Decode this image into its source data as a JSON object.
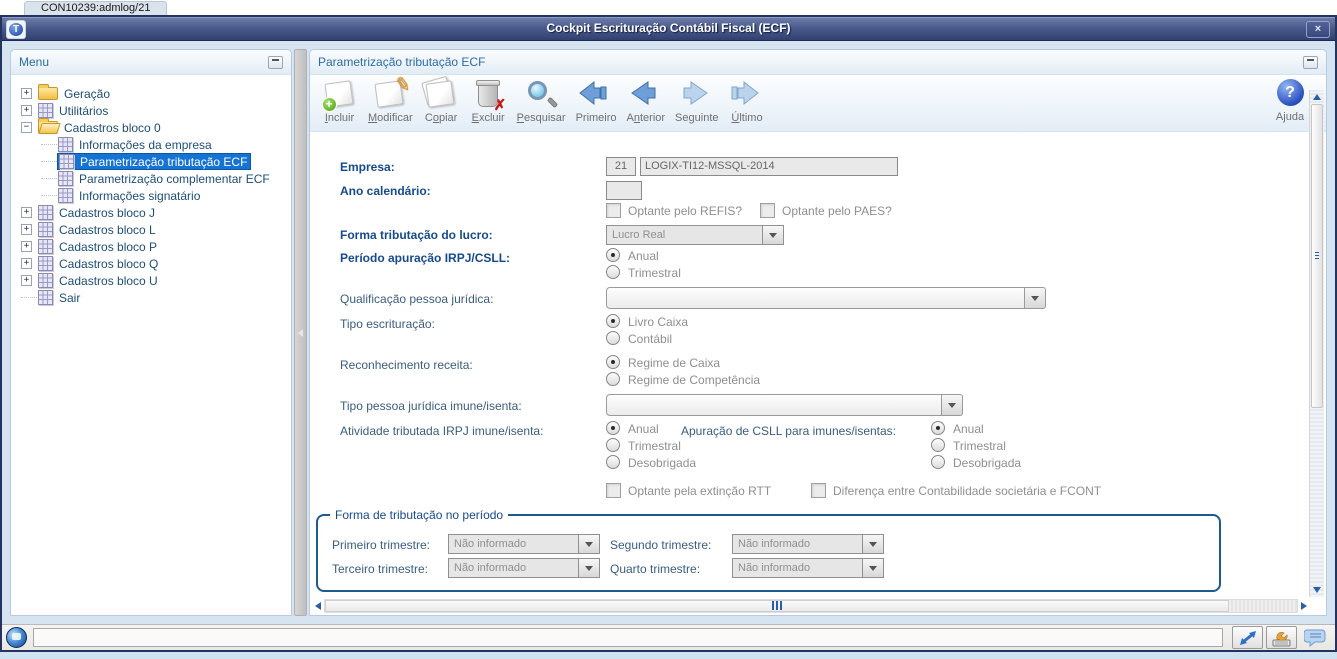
{
  "browser_tab": {
    "label": "CON10239:admlog/21"
  },
  "window": {
    "title": "Cockpit Escrituração Contábil Fiscal (ECF)",
    "logo_letter": "T",
    "close_glyph": "×"
  },
  "left_panel": {
    "header": "Menu",
    "tree": [
      {
        "label": "Geração",
        "icon": "folder",
        "expander": "plus",
        "depth": 0,
        "selected": false
      },
      {
        "label": "Utilitários",
        "icon": "grid",
        "expander": "plus",
        "depth": 0,
        "selected": false
      },
      {
        "label": "Cadastros bloco 0",
        "icon": "folder-open",
        "expander": "minus",
        "depth": 0,
        "selected": false
      },
      {
        "label": "Informações da empresa",
        "icon": "grid",
        "expander": "none",
        "depth": 1,
        "selected": false
      },
      {
        "label": "Parametrização tributação ECF",
        "icon": "grid",
        "expander": "none",
        "depth": 1,
        "selected": true
      },
      {
        "label": "Parametrização complementar ECF",
        "icon": "grid",
        "expander": "none",
        "depth": 1,
        "selected": false
      },
      {
        "label": "Informações signatário",
        "icon": "grid",
        "expander": "none",
        "depth": 1,
        "selected": false
      },
      {
        "label": "Cadastros bloco J",
        "icon": "grid",
        "expander": "plus",
        "depth": 0,
        "selected": false
      },
      {
        "label": "Cadastros bloco L",
        "icon": "grid",
        "expander": "plus",
        "depth": 0,
        "selected": false
      },
      {
        "label": "Cadastros bloco P",
        "icon": "grid",
        "expander": "plus",
        "depth": 0,
        "selected": false
      },
      {
        "label": "Cadastros bloco Q",
        "icon": "grid",
        "expander": "plus",
        "depth": 0,
        "selected": false
      },
      {
        "label": "Cadastros bloco U",
        "icon": "grid",
        "expander": "plus",
        "depth": 0,
        "selected": false
      },
      {
        "label": "Sair",
        "icon": "grid",
        "expander": "none",
        "depth": 0,
        "selected": false
      }
    ]
  },
  "right_panel": {
    "header": "Parametrização tributação ECF",
    "toolbar": {
      "buttons": [
        {
          "id": "incluir",
          "pre": "",
          "u": "I",
          "post": "ncluir"
        },
        {
          "id": "modificar",
          "pre": "",
          "u": "M",
          "post": "odificar"
        },
        {
          "id": "copiar",
          "pre": "C",
          "u": "o",
          "post": "piar"
        },
        {
          "id": "excluir",
          "pre": "",
          "u": "E",
          "post": "xcluir"
        },
        {
          "id": "pesquisar",
          "pre": "",
          "u": "P",
          "post": "esquisar"
        },
        {
          "id": "primeiro",
          "pre": "Primeiro",
          "u": "",
          "post": ""
        },
        {
          "id": "anterior",
          "pre": "A",
          "u": "n",
          "post": "terior"
        },
        {
          "id": "seguinte",
          "pre": "Se",
          "u": "g",
          "post": "uinte"
        },
        {
          "id": "ultimo",
          "pre": "",
          "u": "Ú",
          "post": "ltimo"
        }
      ],
      "help_label": "Ajuda"
    },
    "form": {
      "empresa": {
        "label": "Empresa:",
        "code": "21",
        "name": "LOGIX-TI12-MSSQL-2014"
      },
      "ano": {
        "label": "Ano calendário:",
        "value": ""
      },
      "refis": {
        "label": "Optante pelo REFIS?",
        "checked": false
      },
      "paes": {
        "label": "Optante pelo PAES?",
        "checked": false
      },
      "forma_tributacao": {
        "label": "Forma tributação do lucro:",
        "value": "Lucro Real"
      },
      "periodo_apuracao": {
        "label": "Período apuração IRPJ/CSLL:",
        "options": [
          {
            "label": "Anual",
            "selected": true
          },
          {
            "label": "Trimestral",
            "selected": false
          }
        ]
      },
      "qualificacao": {
        "label": "Qualificação pessoa jurídica:",
        "value": ""
      },
      "tipo_escrituracao": {
        "label": "Tipo escrituração:",
        "options": [
          {
            "label": "Livro Caixa",
            "selected": true
          },
          {
            "label": "Contábil",
            "selected": false
          }
        ]
      },
      "reconhecimento": {
        "label": "Reconhecimento receita:",
        "options": [
          {
            "label": "Regime de Caixa",
            "selected": true
          },
          {
            "label": "Regime de Competência",
            "selected": false
          }
        ]
      },
      "tipo_pj": {
        "label": "Tipo pessoa jurídica imune/isenta:",
        "value": ""
      },
      "atividade_irpj": {
        "label": "Atividade tributada IRPJ imune/isenta:",
        "options": [
          {
            "label": "Anual",
            "selected": true
          },
          {
            "label": "Trimestral",
            "selected": false
          },
          {
            "label": "Desobrigada",
            "selected": false
          }
        ]
      },
      "apuracao_csll": {
        "label": "Apuração de CSLL para imunes/isentas:",
        "options": [
          {
            "label": "Anual",
            "selected": true
          },
          {
            "label": "Trimestral",
            "selected": false
          },
          {
            "label": "Desobrigada",
            "selected": false
          }
        ]
      },
      "rtt": {
        "label": "Optante pela extinção RTT",
        "checked": false
      },
      "fcont": {
        "label": "Diferença entre Contabilidade societária e FCONT",
        "checked": false
      }
    },
    "fieldset": {
      "legend": "Forma de tributação no período",
      "fields": [
        {
          "label": "Primeiro trimestre:",
          "value": "Não informado"
        },
        {
          "label": "Segundo trimestre:",
          "value": "Não informado"
        },
        {
          "label": "Terceiro trimestre:",
          "value": "Não informado"
        },
        {
          "label": "Quarto trimestre:",
          "value": "Não informado"
        }
      ]
    }
  },
  "colors": {
    "selected_item_bg": "#1573d4",
    "label_bold": "#164a8c",
    "panel_header_text": "#2a6ca5",
    "fieldset_border": "#1d5a8f",
    "disabled_text": "#8f8f8f",
    "titlebar_gradient_top": "#6b7ba8",
    "titlebar_gradient_bottom": "#31406f"
  }
}
